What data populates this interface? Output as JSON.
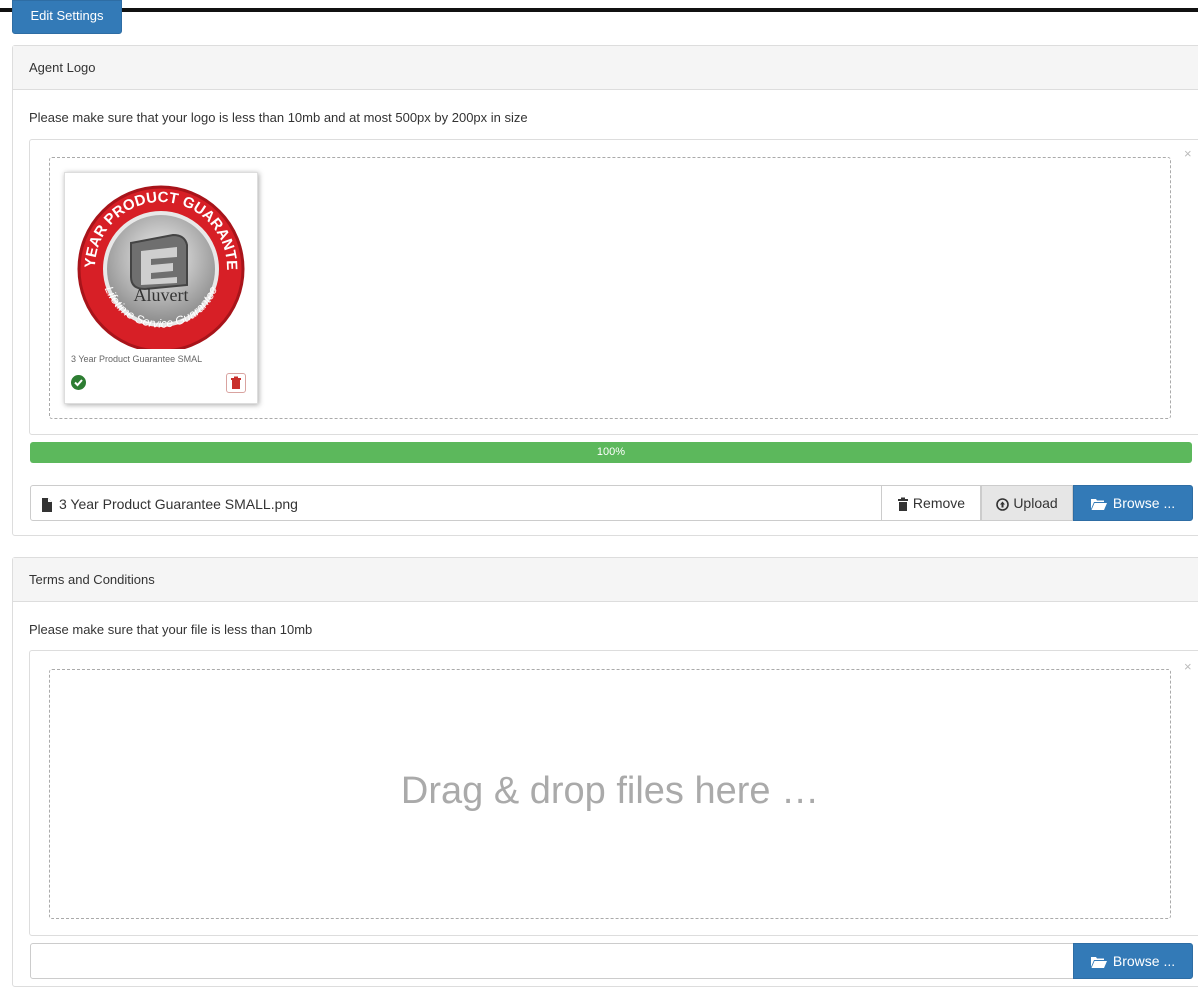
{
  "header": {
    "edit_settings_label": "Edit Settings"
  },
  "agent_logo": {
    "title": "Agent Logo",
    "help_text": "Please make sure that your logo is less than 10mb and at most 500px by 200px in size",
    "close_symbol": "×",
    "preview": {
      "caption": "3 Year Product Guarantee SMAL",
      "logo_ring_top": "3 YEAR PRODUCT GUARANTEE",
      "logo_ring_bottom": "Lifetime Service Guarantee",
      "logo_brand": "Aluvert",
      "status_icon": "check-circle-icon",
      "delete_icon": "trash-icon"
    },
    "progress": {
      "value": 100,
      "label": "100%"
    },
    "file_name": "3 Year Product Guarantee SMALL.png",
    "buttons": {
      "remove": "Remove",
      "upload": "Upload",
      "browse": "Browse ..."
    }
  },
  "terms": {
    "title": "Terms and Conditions",
    "help_text": "Please make sure that your file is less than 10mb",
    "close_symbol": "×",
    "drop_text": "Drag & drop files here …",
    "buttons": {
      "browse": "Browse ..."
    }
  },
  "colors": {
    "primary": "#337ab7",
    "success": "#5cb85c",
    "danger": "#c9302c",
    "logo_red": "#d71f26"
  }
}
